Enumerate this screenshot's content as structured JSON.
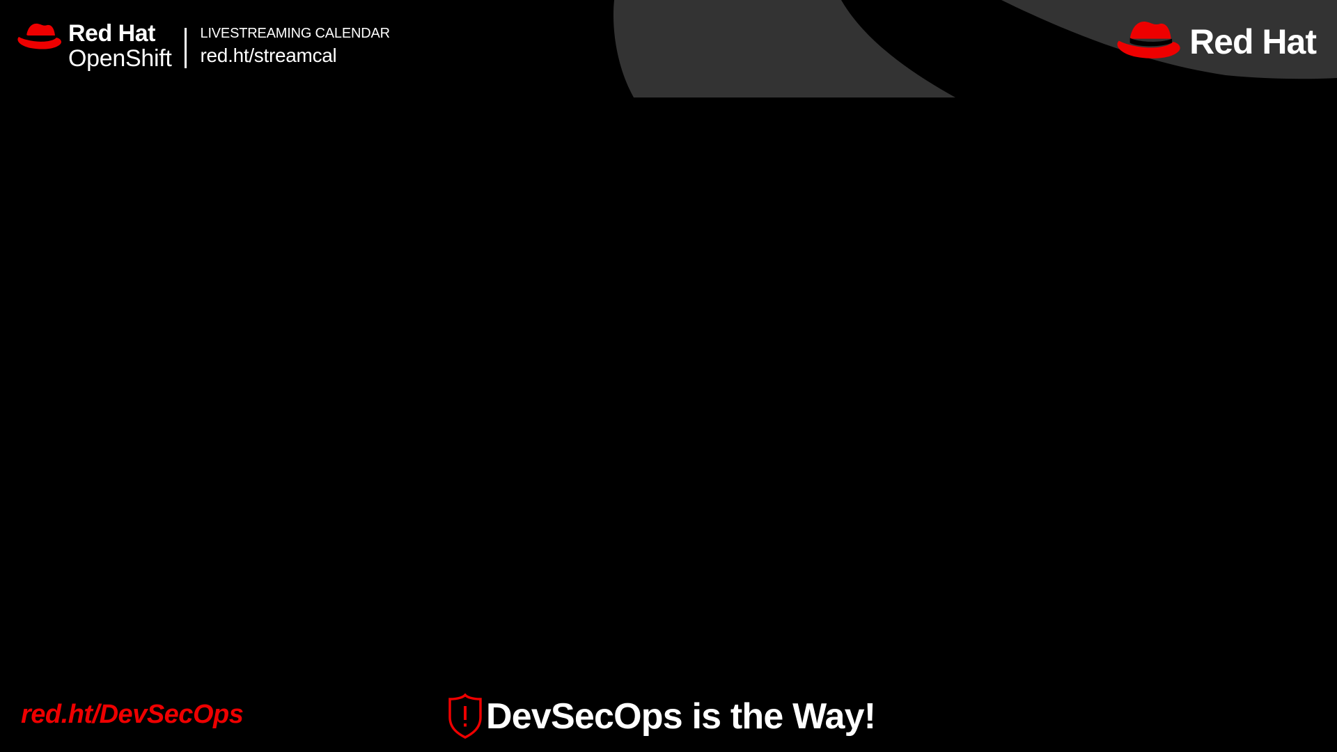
{
  "header": {
    "brand_top": "Red Hat",
    "brand_product": "OpenShift",
    "calendar_label": "LIVESTREAMING CALENDAR",
    "calendar_url": "red.ht/streamcal",
    "brand_right": "Red Hat"
  },
  "footer": {
    "link": "red.ht/DevSecOps",
    "title": "DevSecOps is the Way!"
  },
  "colors": {
    "background": "#000000",
    "accent": "#ee0000",
    "shape": "#333333",
    "text": "#ffffff"
  },
  "icons": [
    "red-hat-fedora-icon",
    "shield-alert-icon"
  ]
}
